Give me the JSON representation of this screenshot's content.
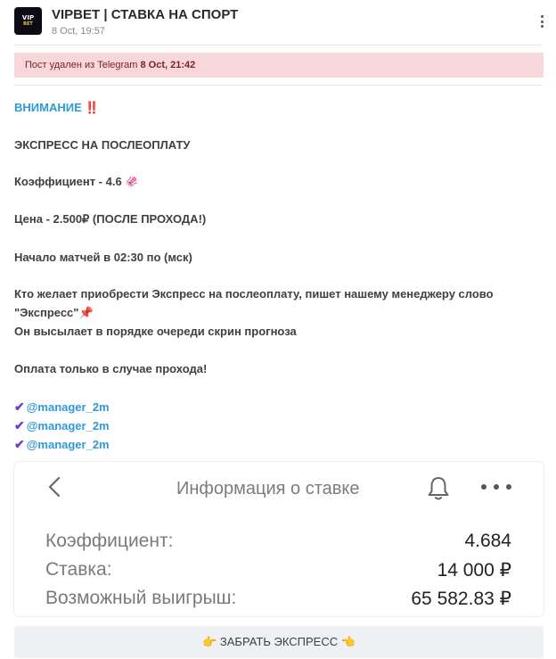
{
  "header": {
    "avatar_line1": "VIP",
    "avatar_line2": "BET",
    "channel_title": "VIPBET | СТАВКА НА СПОРТ",
    "post_date": "8 Oct, 19:57"
  },
  "banner": {
    "text": "Пост удален из Telegram ",
    "date": "8 Oct, 21:42"
  },
  "post": {
    "attention": "ВНИМАНИЕ",
    "attention_emoji": "‼️",
    "express": "ЭКСПРЕСС НА ПОСЛЕОПЛАТУ",
    "coef": "Коэффициент - 4.6",
    "coef_emoji": "🦑",
    "price": "Цена - 2.500₽ (ПОСЛЕ ПРОХОДА!)",
    "start": "Начало матчей в 02:30 по (мск)",
    "buy_line1": "Кто желает приобрести Экспресс на послеоплату, пишет нашему менеджеру слово",
    "buy_line2": "\"Экспресс\"",
    "pin_emoji": "📌",
    "buy_line3": "Он высылает в порядке очереди скрин прогноза",
    "payment": "Оплата только в случае прохода!",
    "check_emoji": "✔",
    "links": [
      "@manager_2m",
      "@manager_2m",
      "@manager_2m"
    ]
  },
  "screenshot": {
    "title": "Информация о ставке",
    "rows": [
      {
        "label": "Коэффициент:",
        "value": "4.684"
      },
      {
        "label": "Ставка:",
        "value": "14 000 ₽"
      },
      {
        "label": "Возможный выигрыш:",
        "value": "65 582.83 ₽"
      }
    ]
  },
  "claim": {
    "emoji_left": "👉",
    "label": "ЗАБРАТЬ ЭКСПРЕСС",
    "emoji_right": "👈"
  },
  "icons": {
    "menu": "more-vertical-icon",
    "back": "chevron-left-icon",
    "bell": "bell-icon",
    "more": "more-horizontal-icon",
    "check": "check-icon"
  },
  "colors": {
    "link": "#2e9bd6",
    "banner_bg": "#f8d7da",
    "banner_text": "#7a1f27",
    "check": "#6b3fd3",
    "button_bg": "#eef0f3"
  }
}
